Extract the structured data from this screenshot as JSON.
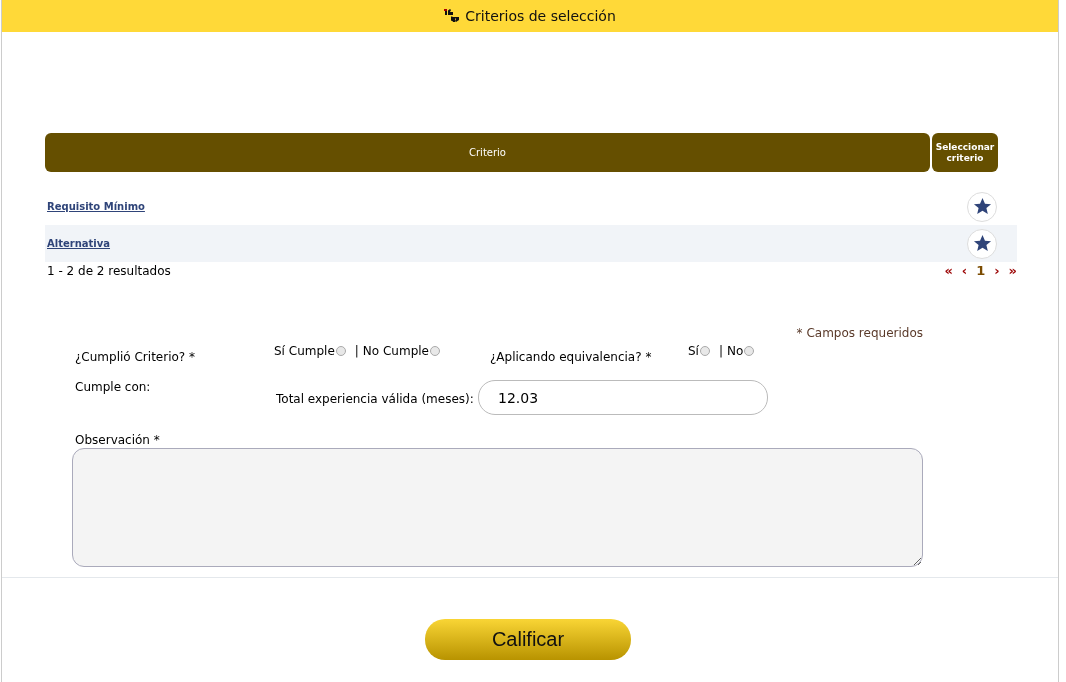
{
  "header": {
    "title": "Criterios de selección"
  },
  "table": {
    "columns": [
      "Criterio",
      "Seleccionar criterio"
    ],
    "rows": [
      {
        "criterio": "Requisito Mínimo"
      },
      {
        "criterio": "Alternativa"
      }
    ]
  },
  "pagination": {
    "summary": "1 - 2 de 2 resultados",
    "first": "«",
    "prev": "‹",
    "page": "1",
    "next": "›",
    "last": "»"
  },
  "form": {
    "required_note": "* Campos requeridos",
    "questions": [
      {
        "label": "¿Cumplió Criterio? *",
        "separator": "|",
        "options": [
          {
            "label": "Sí Cumple",
            "checked": false
          },
          {
            "label": "No Cumple",
            "checked": false
          }
        ]
      },
      {
        "label": "¿Aplicando equivalencia? *",
        "separator": "|",
        "options": [
          {
            "label": "Sí",
            "checked": false
          },
          {
            "label": "No",
            "checked": false
          }
        ]
      }
    ],
    "cumple_con": "Cumple con:",
    "experience": {
      "label": "Total experiencia válida (meses):",
      "value": "12.03"
    },
    "observation": {
      "label": "Observación *"
    }
  },
  "submit": "Calificar"
}
